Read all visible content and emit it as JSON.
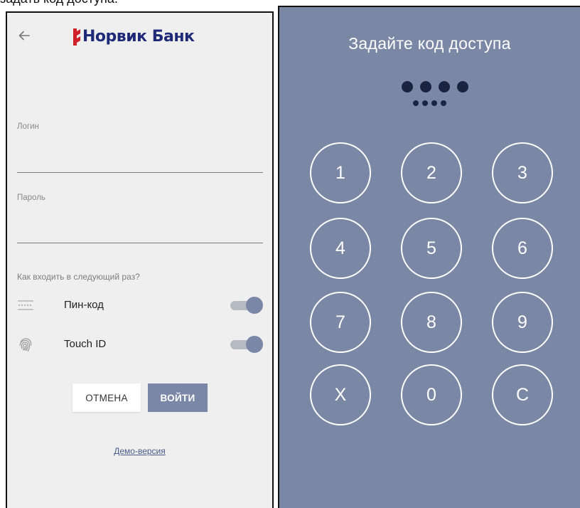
{
  "caption": "задать код доступа.",
  "login_screen": {
    "logo_text": "Норвик Банк",
    "login_label": "Логин",
    "password_label": "Пароль",
    "next_time_label": "Как входить в следующий раз?",
    "options": [
      {
        "label": "Пин-код",
        "icon": "pin-dots-icon",
        "enabled": true
      },
      {
        "label": "Touch ID",
        "icon": "fingerprint-icon",
        "enabled": true
      }
    ],
    "cancel_label": "ОТМЕНА",
    "login_button_label": "ВОЙТИ",
    "demo_link": "Демо-версия"
  },
  "pin_screen": {
    "title": "Задайте код доступа",
    "entered_dots": 4,
    "keys": [
      "1",
      "2",
      "3",
      "4",
      "5",
      "6",
      "7",
      "8",
      "9",
      "X",
      "0",
      "C"
    ]
  },
  "colors": {
    "brand_blue": "#1e2a78",
    "brand_red": "#d0202a",
    "accent": "#7a87a6",
    "pin_background": "#7b88a5",
    "panel_background": "#efefef"
  }
}
